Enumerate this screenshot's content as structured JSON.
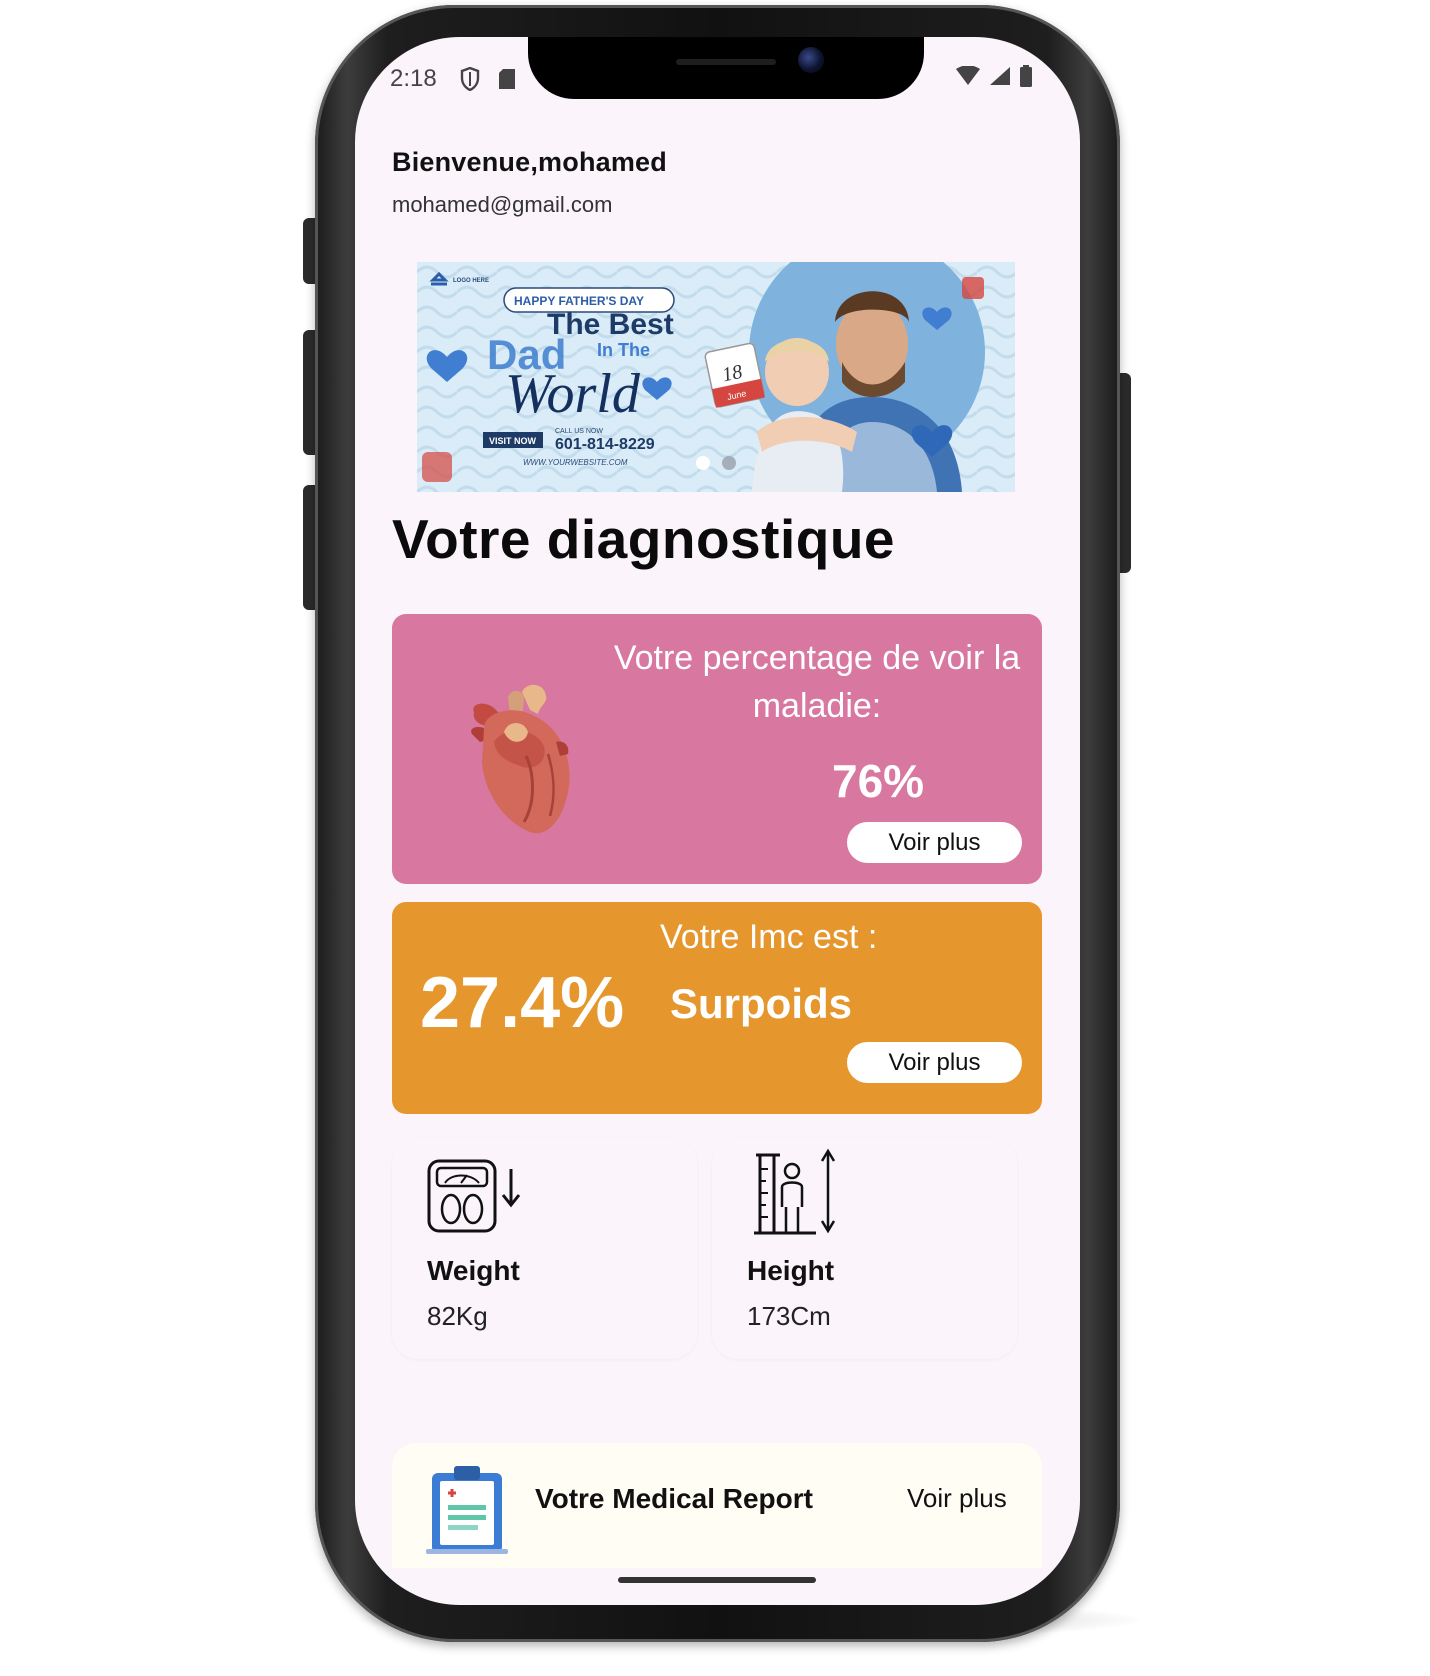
{
  "status_bar": {
    "time": "2:18"
  },
  "header": {
    "greeting": "Bienvenue,mohamed",
    "email": "mohamed@gmail.com"
  },
  "banner": {
    "tag": "HAPPY FATHER'S DAY",
    "headline_1": "The Best",
    "headline_2": "Dad",
    "headline_3": "In The",
    "headline_4": "World",
    "cta": "VISIT NOW",
    "call_label": "CALL US NOW",
    "phone": "601-814-8229",
    "website": "WWW.YOURWEBSITE.COM",
    "logo": "LOGO HERE",
    "calendar_day": "18",
    "calendar_month": "June",
    "active_slide": 1,
    "slide_count": 2
  },
  "main": {
    "heading": "Votre diagnostique"
  },
  "disease_card": {
    "title": "Votre percentage de voir la maladie:",
    "value": "76%",
    "button": "Voir plus",
    "color": "#d877a0"
  },
  "imc_card": {
    "title": "Votre Imc est :",
    "value": "27.4%",
    "status": "Surpoids",
    "button": "Voir plus",
    "color": "#e5962c"
  },
  "weight": {
    "label": "Weight",
    "value": "82Kg"
  },
  "height": {
    "label": "Height",
    "value": "173Cm"
  },
  "report": {
    "title": "Votre Medical Report",
    "button": "Voir plus"
  }
}
